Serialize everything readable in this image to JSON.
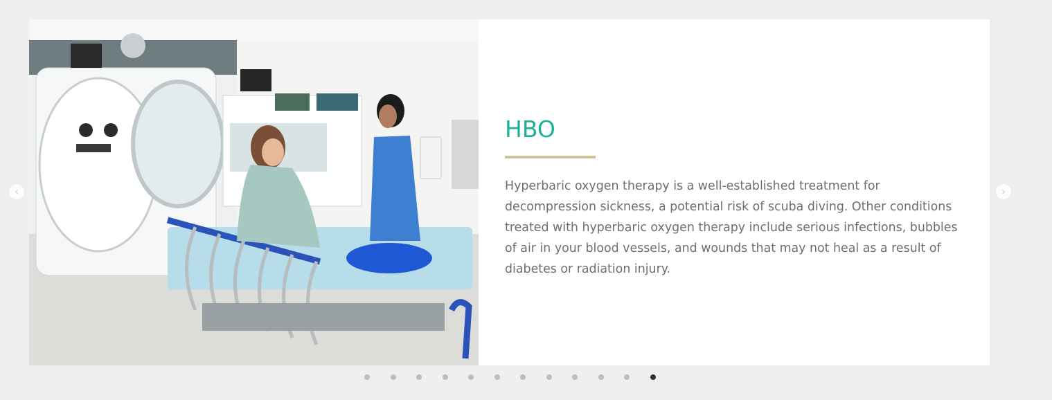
{
  "slider": {
    "prev_arrow": "‹",
    "next_arrow": "›",
    "slide": {
      "title": "HBO",
      "text": "Hyperbaric oxygen therapy is a well-established treatment for decompression sickness, a potential risk of scuba diving. Other conditions treated with hyperbaric oxygen therapy include serious infections, bubbles of air in your blood vessels, and wounds that may not heal as a result of diabetes or radiation injury.",
      "image_icon": "photo-hyperbaric-chamber"
    },
    "dots_count": 12,
    "active_dot": 12
  },
  "colors": {
    "accent": "#1fb299",
    "rule": "#d2c29a",
    "text": "#6c6e73",
    "background": "#efefef"
  }
}
